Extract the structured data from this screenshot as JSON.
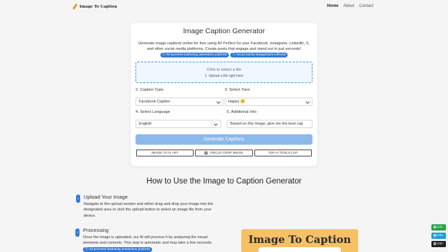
{
  "nav": {
    "logo_text": "Image To Caption",
    "links": [
      "Home",
      "About",
      "Contact"
    ]
  },
  "generator": {
    "title": "Image Caption Generator",
    "description": "Generate image captions online for free using AI! Perfect for your Facebook, Instagram, LinkedIn, X, and other social media platforms. Create posts that engage and stand out in just seconds!",
    "pill_1": "AI-powered marketing automation platform",
    "pill_2": "Social media management software",
    "upload_main": "Click to select a file",
    "upload_sub": "1. Upload a file right here",
    "caption_type_label": "2. Caption Type",
    "caption_type_value": "Facebook Caption",
    "tone_label": "3. Select Tone",
    "tone_value": "Happy 😊",
    "language_label": "4. Select Language",
    "language_value": "English",
    "info_label": "5. Additional Info",
    "info_value": "Based on this image, give me the best cap",
    "generate_button": "Generate Captions",
    "tool_buttons": [
      "IMAGE TO AI ART",
      "CIRCLE CROP IMAGE",
      "TOP AI TOOLS LIST"
    ]
  },
  "howto": {
    "title": "How to Use the Image to Caption Generator",
    "steps": [
      {
        "num": "1",
        "title": "Upload Your Image",
        "text": "Navigate to the upload section and either drag and drop your image into the designated area or click the upload button to select an image file from your device."
      },
      {
        "num": "2",
        "title": "Processing",
        "text": "Once the image is uploaded, our AI will process it by analyzing the visual elements and contexts. This step is automatic and may take a few seconds.",
        "pill": "AI-powered marketing automation platform"
      }
    ]
  },
  "preview": {
    "title": "Image To Caption"
  },
  "share": [
    {
      "label": "Join",
      "icon": "whatsapp-icon",
      "color": "#25a244"
    },
    {
      "label": "Join",
      "icon": "telegram-icon",
      "color": "#1d9bd7"
    },
    {
      "label": "Join",
      "icon": "facebook-icon",
      "color": "#222222"
    }
  ]
}
